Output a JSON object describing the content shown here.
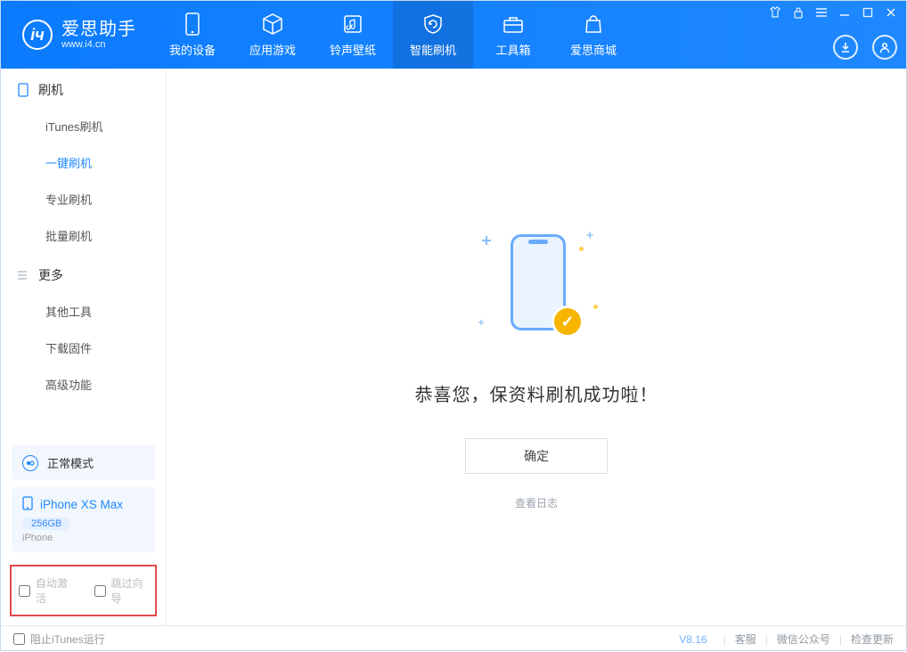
{
  "app": {
    "title": "爱思助手",
    "subtitle": "www.i4.cn"
  },
  "nav": [
    "我的设备",
    "应用游戏",
    "铃声壁纸",
    "智能刷机",
    "工具箱",
    "爱思商城"
  ],
  "sidebar": {
    "group1": {
      "title": "刷机",
      "items": [
        "iTunes刷机",
        "一键刷机",
        "专业刷机",
        "批量刷机"
      ],
      "activeIndex": 1
    },
    "group2": {
      "title": "更多",
      "items": [
        "其他工具",
        "下载固件",
        "高级功能"
      ]
    }
  },
  "mode": {
    "label": "正常模式"
  },
  "device": {
    "name": "iPhone XS Max",
    "storage": "256GB",
    "type": "iPhone"
  },
  "options": {
    "autoActivate": "自动激活",
    "skipWizard": "跳过向导"
  },
  "main": {
    "successText": "恭喜您，保资料刷机成功啦！",
    "okButton": "确定",
    "viewLog": "查看日志"
  },
  "statusbar": {
    "blockItunes": "阻止iTunes运行",
    "version": "V8.16",
    "links": [
      "客服",
      "微信公众号",
      "检查更新"
    ]
  }
}
